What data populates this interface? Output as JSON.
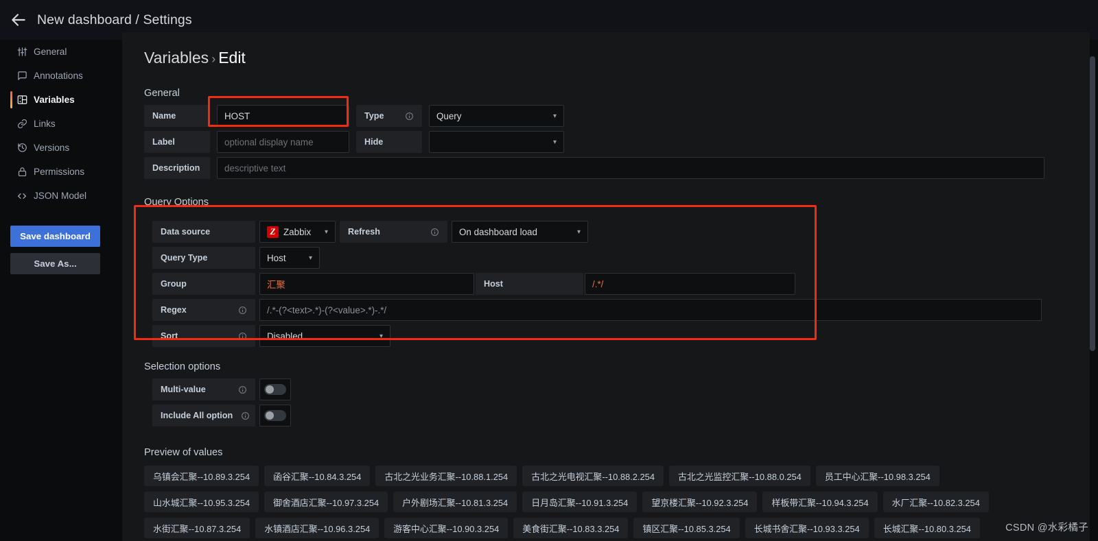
{
  "header": {
    "back_icon": "arrow-left-icon",
    "title": "New dashboard / Settings"
  },
  "sidebar": {
    "items": [
      {
        "label": "General",
        "icon": "sliders-icon"
      },
      {
        "label": "Annotations",
        "icon": "comment-icon"
      },
      {
        "label": "Variables",
        "icon": "grid-icon"
      },
      {
        "label": "Links",
        "icon": "link-icon"
      },
      {
        "label": "Versions",
        "icon": "history-icon"
      },
      {
        "label": "Permissions",
        "icon": "lock-icon"
      },
      {
        "label": "JSON Model",
        "icon": "code-icon"
      }
    ],
    "active_index": 2,
    "save_dashboard_label": "Save dashboard",
    "save_as_label": "Save As..."
  },
  "breadcrumb": {
    "root": "Variables",
    "separator": "›",
    "current": "Edit"
  },
  "general": {
    "section_title": "General",
    "name_label": "Name",
    "name_value": "HOST",
    "type_label": "Type",
    "type_value": "Query",
    "label_label": "Label",
    "label_placeholder": "optional display name",
    "hide_label": "Hide",
    "hide_value": "",
    "description_label": "Description",
    "description_placeholder": "descriptive text"
  },
  "query_options": {
    "section_title": "Query Options",
    "data_source_label": "Data source",
    "data_source_value": "Zabbix",
    "data_source_icon": "zabbix-logo-icon",
    "refresh_label": "Refresh",
    "refresh_value": "On dashboard load",
    "query_type_label": "Query Type",
    "query_type_value": "Host",
    "group_label": "Group",
    "group_value": "汇聚",
    "host_label": "Host",
    "host_value": "/.*/",
    "regex_label": "Regex",
    "regex_value": "/.*-(?<text>.*)-(?<value>.*)-.*/",
    "sort_label": "Sort",
    "sort_value": "Disabled"
  },
  "selection_options": {
    "section_title": "Selection options",
    "multi_value_label": "Multi-value",
    "multi_value_state": "off",
    "include_all_label": "Include All option",
    "include_all_state": "off"
  },
  "preview": {
    "section_title": "Preview of values",
    "values": [
      "乌镇会汇聚--10.89.3.254",
      "函谷汇聚--10.84.3.254",
      "古北之光业务汇聚--10.88.1.254",
      "古北之光电视汇聚--10.88.2.254",
      "古北之光监控汇聚--10.88.0.254",
      "员工中心汇聚--10.98.3.254",
      "山水城汇聚--10.95.3.254",
      "御舍酒店汇聚--10.97.3.254",
      "户外剧场汇聚--10.81.3.254",
      "日月岛汇聚--10.91.3.254",
      "望京楼汇聚--10.92.3.254",
      "样板带汇聚--10.94.3.254",
      "水厂汇聚--10.82.3.254",
      "水街汇聚--10.87.3.254",
      "水镇酒店汇聚--10.96.3.254",
      "游客中心汇聚--10.90.3.254",
      "美食街汇聚--10.83.3.254",
      "镇区汇聚--10.85.3.254",
      "长城书舍汇聚--10.93.3.254",
      "长城汇聚--10.80.3.254"
    ]
  },
  "watermark": "CSDN @水彩橘子",
  "colors": {
    "accent_blue": "#3d71d9",
    "highlight_red": "#f52a0f",
    "zabbix_red": "#d40000",
    "value_orange": "#e8703a",
    "panel_bg": "#161719",
    "app_bg": "#0b0c0e"
  }
}
